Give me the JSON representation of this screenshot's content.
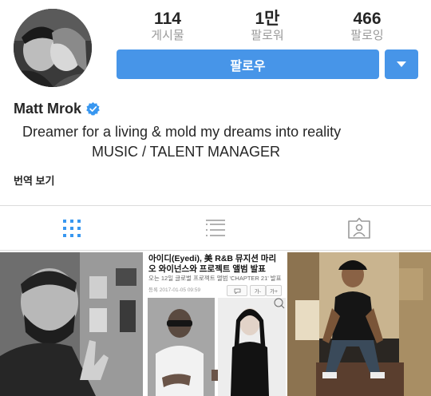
{
  "profile": {
    "name": "Matt Mrok",
    "bio_line1": "Dreamer for a living & mold my dreams into reality",
    "bio_line2": "MUSIC / TALENT MANAGER",
    "translate_label": "번역 보기"
  },
  "stats": [
    {
      "value": "114",
      "label": "게시물"
    },
    {
      "value": "1만",
      "label": "팔로워"
    },
    {
      "value": "466",
      "label": "팔로잉"
    }
  ],
  "actions": {
    "follow_label": "팔로우",
    "dropdown_icon": "triangle-down-icon"
  },
  "tabs": [
    {
      "name": "grid-view",
      "icon": "grid-icon",
      "active": true
    },
    {
      "name": "list-view",
      "icon": "list-icon",
      "active": false
    },
    {
      "name": "tagged-view",
      "icon": "tagged-person-icon",
      "active": false
    }
  ],
  "grid": {
    "news": {
      "headline": "아이디(Eyedi), 美 R&B 뮤지션 마리오 와이넌스와 프로젝트 앨범 발표",
      "subline": "오는 12일 글로벌 프로젝트 앨범 'CHAPTER 21' 발표",
      "date": "등록 2017-01-05 09:59",
      "font_small": "가-",
      "font_large": "가+"
    }
  },
  "colors": {
    "accent": "#4795e8",
    "active_tab": "#3897f0",
    "muted": "#9a9a9a",
    "verified": "#3897f0"
  }
}
